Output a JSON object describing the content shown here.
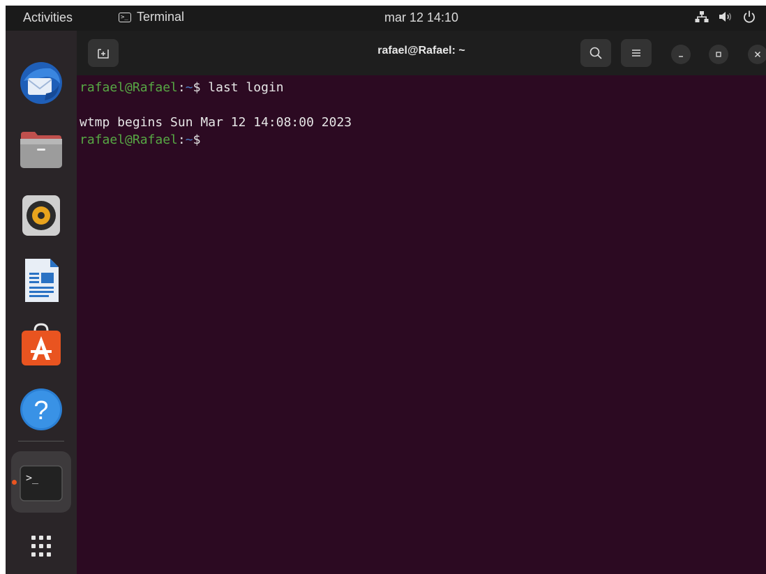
{
  "topbar": {
    "activities": "Activities",
    "app_name": "Terminal",
    "clock": "mar 12  14:10"
  },
  "dock": {
    "items": [
      "thunderbird-icon",
      "files-icon",
      "rhythmbox-icon",
      "libreoffice-writer-icon",
      "software-icon",
      "help-icon",
      "terminal-icon",
      "show-apps-icon"
    ],
    "running_app": "terminal"
  },
  "window": {
    "title": "rafael@Rafael: ~"
  },
  "terminal": {
    "lines": [
      {
        "prompt_user": "rafael@Rafael",
        "prompt_sep": ":",
        "prompt_path": "~",
        "prompt_sign": "$ ",
        "command": "last login"
      },
      {
        "output": ""
      },
      {
        "output": "wtmp begins Sun Mar 12 14:08:00 2023"
      },
      {
        "prompt_user": "rafael@Rafael",
        "prompt_sep": ":",
        "prompt_path": "~",
        "prompt_sign": "$ ",
        "command": ""
      }
    ]
  },
  "colors": {
    "terminal_bg": "#2c0a22",
    "prompt_user": "#57a844",
    "prompt_path": "#4a7cc4",
    "accent": "#e95420"
  }
}
